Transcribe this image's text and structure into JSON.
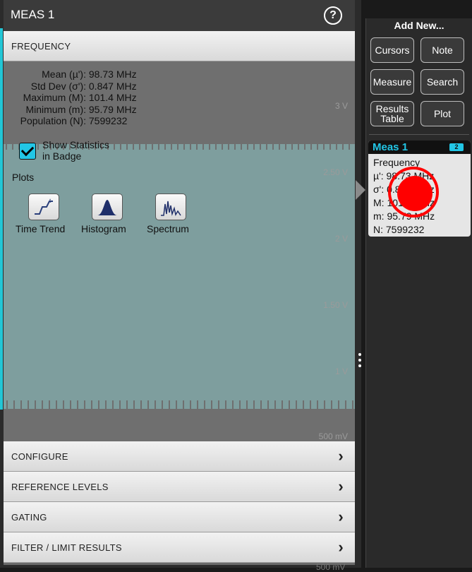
{
  "panel": {
    "title": "MEAS 1",
    "help_glyph": "?",
    "section": "FREQUENCY",
    "stats": [
      {
        "label": "Mean (µ'):",
        "value": "98.73 MHz"
      },
      {
        "label": "Std Dev (σ'):",
        "value": "0.847 MHz"
      },
      {
        "label": "Maximum (M):",
        "value": "101.4 MHz"
      },
      {
        "label": "Minimum (m):",
        "value": "95.79 MHz"
      },
      {
        "label": "Population (N):",
        "value": "7599232"
      }
    ],
    "show_stats": {
      "line1": "Show Statistics",
      "line2": "in Badge",
      "checked": true
    },
    "plots_label": "Plots",
    "plots": [
      {
        "label": "Time Trend",
        "icon": "time-trend-icon"
      },
      {
        "label": "Histogram",
        "icon": "histogram-icon"
      },
      {
        "label": "Spectrum",
        "icon": "spectrum-icon"
      }
    ],
    "bottom_sections": [
      "CONFIGURE",
      "REFERENCE LEVELS",
      "GATING",
      "FILTER / LIMIT RESULTS"
    ]
  },
  "waveform": {
    "volt_labels": [
      "3 V",
      "2.50 V",
      "2 V",
      "1.50 V",
      "1 V",
      "500 mV"
    ],
    "bottom_label": "500 mV"
  },
  "right_panel": {
    "add_new": "Add New...",
    "buttons": [
      {
        "label": "Cursors"
      },
      {
        "label": "Note"
      },
      {
        "label": "Measure"
      },
      {
        "label": "Search"
      },
      {
        "label": "Results\nTable"
      },
      {
        "label": "Plot"
      }
    ]
  },
  "badge": {
    "title": "Meas 1",
    "number": "2",
    "lines": [
      "Frequency",
      "µ': 98.73 MHz",
      "σ': 0.847 MHz",
      "M: 101.4 MHz",
      "m: 95.79 MHz",
      "N: 7599232"
    ]
  },
  "colors": {
    "accent": "#22c6e6",
    "touch_indicator": "#ff0000",
    "waveform": "#7e9e9e"
  }
}
